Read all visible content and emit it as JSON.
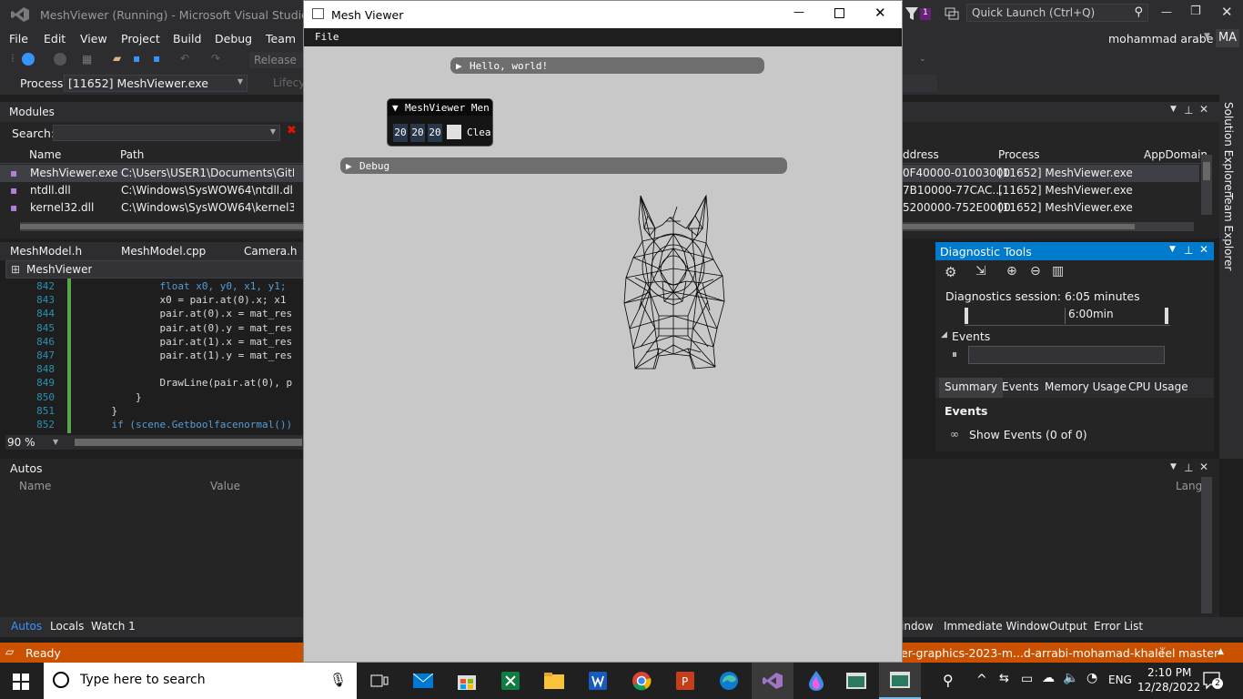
{
  "vs": {
    "title": "MeshViewer (Running) - Microsoft Visual Studio",
    "menu": [
      "File",
      "Edit",
      "View",
      "Project",
      "Build",
      "Debug",
      "Team"
    ],
    "toolbar_config": "Release",
    "process_label": "Process:",
    "process_value": "[11652] MeshViewer.exe",
    "lifecycle": "Lifecyc",
    "quick_launch": "Quick Launch (Ctrl+Q)",
    "user": "mohammad arabe",
    "user_initials": "MA",
    "notif_count": "1"
  },
  "modules": {
    "title": "Modules",
    "search_label": "Search:",
    "columns": [
      "Name",
      "Path",
      "ddress",
      "Process",
      "AppDomain"
    ],
    "rows": [
      {
        "name": "MeshViewer.exe",
        "path": "C:\\Users\\USER1\\Documents\\GitH...",
        "address": "0F40000-01003000",
        "process": "[11652] MeshViewer.exe"
      },
      {
        "name": "ntdll.dll",
        "path": "C:\\Windows\\SysWOW64\\ntdll.dll",
        "address": "7B10000-77CAC...",
        "process": "[11652] MeshViewer.exe"
      },
      {
        "name": "kernel32.dll",
        "path": "C:\\Windows\\SysWOW64\\kernel32...",
        "address": "5200000-752E0000",
        "process": "[11652] MeshViewer.exe"
      }
    ]
  },
  "editor": {
    "tabs": [
      "MeshModel.h",
      "MeshModel.cpp",
      "Camera.h"
    ],
    "nav": "MeshViewer",
    "lines": [
      {
        "n": "842",
        "t": "            float x0, y0, x1, y1;"
      },
      {
        "n": "843",
        "t": "            x0 = pair.at(0).x; x1"
      },
      {
        "n": "844",
        "t": "            pair.at(0).x = mat_res"
      },
      {
        "n": "845",
        "t": "            pair.at(0).y = mat_res"
      },
      {
        "n": "846",
        "t": "            pair.at(1).x = mat_res"
      },
      {
        "n": "847",
        "t": "            pair.at(1).y = mat_res"
      },
      {
        "n": "848",
        "t": ""
      },
      {
        "n": "849",
        "t": "            DrawLine(pair.at(0), p"
      },
      {
        "n": "850",
        "t": "        }"
      },
      {
        "n": "851",
        "t": "    }"
      },
      {
        "n": "852",
        "t": "    if (scene.Getboolfacenormal())"
      }
    ],
    "zoom": "90 %"
  },
  "autos": {
    "title": "Autos",
    "columns": [
      "Name",
      "Value",
      "Lang"
    ],
    "tabs": [
      "Autos",
      "Locals",
      "Watch 1"
    ]
  },
  "diag": {
    "title": "Diagnostic Tools",
    "session": "Diagnostics session: 6:05 minutes",
    "timeline": "6:00min",
    "events_label": "Events",
    "tabs": [
      "Summary",
      "Events",
      "Memory Usage",
      "CPU Usage"
    ],
    "events_heading": "Events",
    "show_events": "Show Events (0 of 0)"
  },
  "right_tabs": [
    "Solution Explorer",
    "Team Explorer"
  ],
  "bottom_tabs": [
    "indow",
    "Immediate Window",
    "Output",
    "Error List"
  ],
  "status": {
    "ready": "Ready",
    "repo": "er-graphics-2023-m...d-arrabi-mohamad-khaleel",
    "branch": "master"
  },
  "mesh_viewer": {
    "title": "Mesh Viewer",
    "menu_file": "File",
    "hello": "Hello, world!",
    "menu_window_title": "MeshViewer Men",
    "color_values": [
      "20",
      "20",
      "20"
    ],
    "clear_label": "Clea",
    "debug": "Debug"
  },
  "taskbar": {
    "search": "Type here to search",
    "lang": "ENG",
    "time": "2:10 PM",
    "date": "12/28/2022",
    "notif": "2"
  }
}
